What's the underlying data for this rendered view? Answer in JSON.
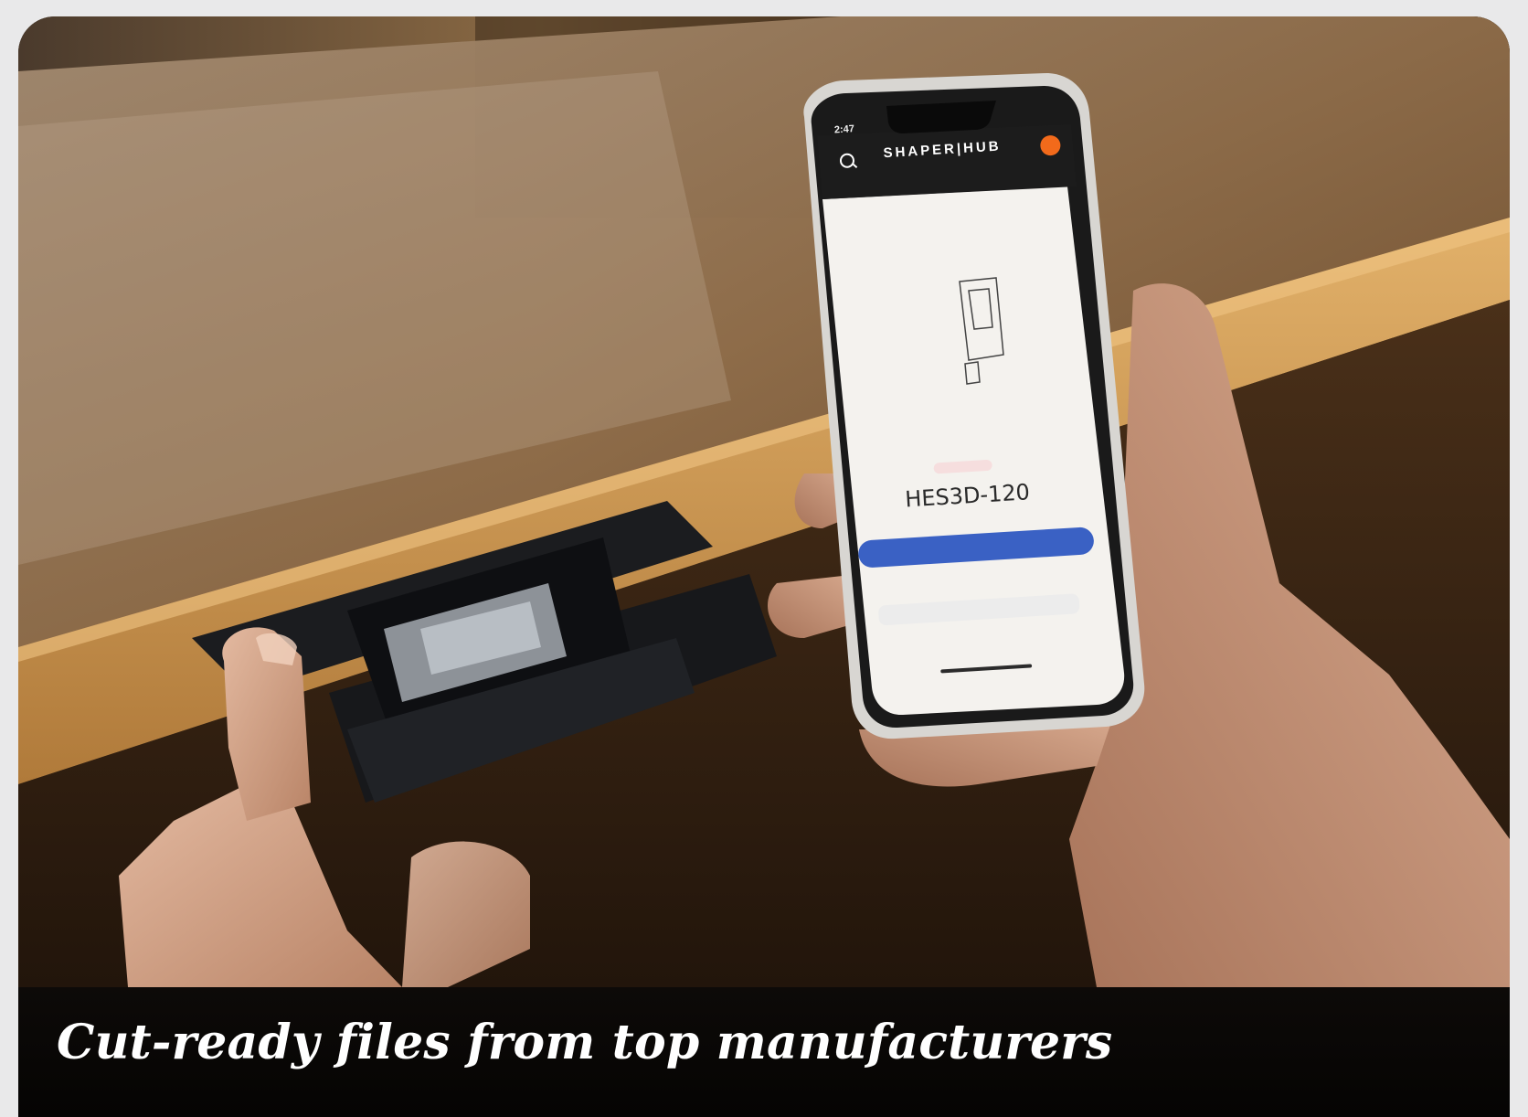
{
  "caption": "Cut-ready files from top manufacturers",
  "phone": {
    "status_time": "2:47",
    "brand": "SHAPER|HUB",
    "product_code": "HES3D-120"
  },
  "colors": {
    "caption_background": "#050403",
    "caption_text": "#ffffff",
    "phone_button": "#3a61c4",
    "avatar": "#f26a1b"
  }
}
